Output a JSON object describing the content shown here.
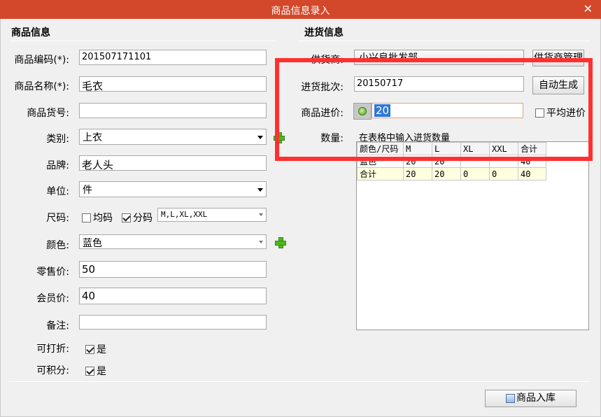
{
  "window": {
    "title": "商品信息录入",
    "close_glyph": "✕"
  },
  "product_section": {
    "title": "商品信息",
    "code": {
      "label": "商品编码(*):",
      "value": "201507171101"
    },
    "name": {
      "label": "商品名称(*):",
      "value": "毛衣"
    },
    "item_no": {
      "label": "商品货号:",
      "value": ""
    },
    "category": {
      "label": "类别:",
      "value": "上衣"
    },
    "brand": {
      "label": "品牌:",
      "value": "老人头"
    },
    "unit": {
      "label": "单位:",
      "value": "件"
    },
    "size": {
      "label": "尺码:",
      "uniform_label": "均码",
      "uniform_checked": false,
      "split_label": "分码",
      "split_checked": true,
      "sizes_value": "M,L,XL,XXL"
    },
    "color": {
      "label": "颜色:",
      "value": "蓝色"
    },
    "retail_price": {
      "label": "零售价:",
      "value": "50"
    },
    "member_price": {
      "label": "会员价:",
      "value": "40"
    },
    "remark": {
      "label": "备注:",
      "value": ""
    },
    "discountable": {
      "label": "可打折:",
      "checkbox_label": "是",
      "checked": true
    },
    "points": {
      "label": "可积分:",
      "checkbox_label": "是",
      "checked": true
    }
  },
  "purchase_section": {
    "title": "进货信息",
    "supplier": {
      "label": "供货商:",
      "value": "小兴良批发部",
      "button": "供货商管理"
    },
    "batch": {
      "label": "进货批次:",
      "value": "20150717",
      "button": "自动生成"
    },
    "price": {
      "label": "商品进价:",
      "value": "20",
      "average_label": "平均进价",
      "average_checked": false
    },
    "quantity": {
      "label": "数量:",
      "hint": "在表格中输入进货数量",
      "columns": [
        "颜色/尺码",
        "M",
        "L",
        "XL",
        "XXL",
        "合计"
      ],
      "rows": [
        [
          "蓝色",
          "20",
          "20",
          "",
          "",
          "40"
        ],
        [
          "合计",
          "20",
          "20",
          "0",
          "0",
          "40"
        ]
      ]
    }
  },
  "footer": {
    "stock_in_button": "商品入库"
  },
  "colors": {
    "titlebar": "#d3482a",
    "highlight": "#ff3030",
    "plus_icon": "#4db81f"
  }
}
